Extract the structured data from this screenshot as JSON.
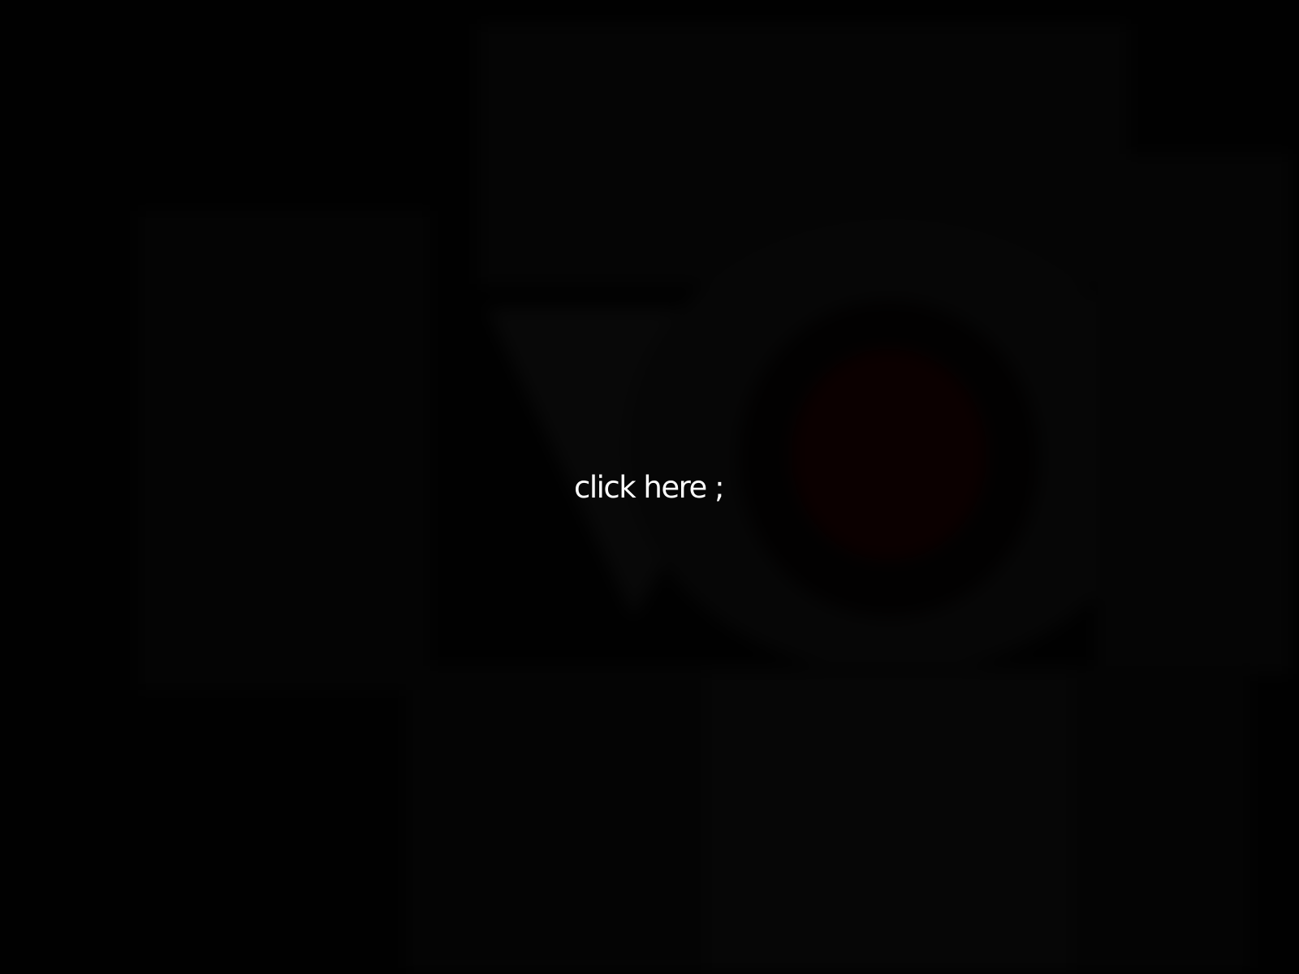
{
  "overlay": {
    "prompt_label": "click here ;"
  },
  "colors": {
    "background": "#000000",
    "backdrop_shape": "#070707",
    "backdrop_accent": "#0b0000",
    "prompt_text": "#ffffff"
  }
}
